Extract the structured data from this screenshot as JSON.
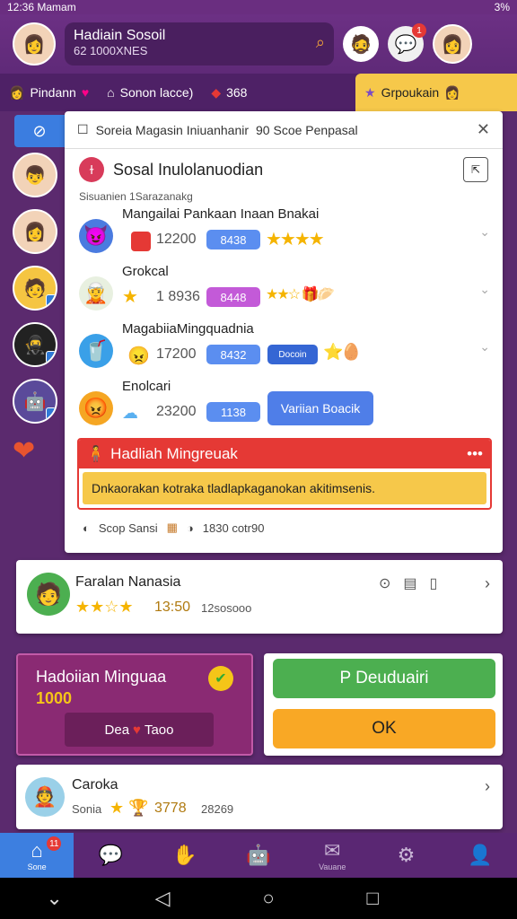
{
  "status": {
    "time": "12:36 Mamam",
    "battery": "3%"
  },
  "header": {
    "name": "Hadiain Sosoil",
    "sub": "62 1000XNES",
    "notif_count": "1"
  },
  "tabs": [
    {
      "label": "Pindann"
    },
    {
      "label": "Sonon lacce)"
    },
    {
      "label": "368"
    },
    {
      "label": "Grpoukain"
    }
  ],
  "panel": {
    "header_text": "Soreia Magasin Iniuanhanir",
    "header_extra": "90 Scoe Penpasal",
    "section_title": "Sosal Inulolanuodian",
    "subtitle": "Sisuanien 1Sarazanakg",
    "rows": [
      {
        "title": "Mangailai Pankaan Inaan Bnakai",
        "extra": "38",
        "score": "12200",
        "pill": "8438"
      },
      {
        "title": "Grokcal",
        "score": "1 8936",
        "pill": "8448"
      },
      {
        "title": "MagabiiaMingquadnia",
        "score": "17200",
        "pill": "8432",
        "pill2": "Docoin"
      },
      {
        "title": "Enolcari",
        "score": "23200",
        "pill": "1138",
        "button": "Variian Boacik"
      }
    ],
    "alert_title": "Hadliah Mingreuak",
    "alert_body": "Dnkaorakan kotraka tladlapkaganokan akitimsenis.",
    "footer_a": "Scop Sansi",
    "footer_b": "1830 cotr90"
  },
  "card1": {
    "title": "Faralan Nanasia",
    "score": "13:50",
    "sub": "12sosooo"
  },
  "promo": {
    "title": "Hadoiian Minguaa",
    "amount": "1000",
    "btn": "Dea",
    "btn2": "Taoo"
  },
  "actions": {
    "green": "P Deuduairi",
    "orange": "OK"
  },
  "card2": {
    "title": "Caroka",
    "sub": "Sonia",
    "score": "3778",
    "extra": "28269"
  },
  "nav": {
    "home": "Sone",
    "mail": "Vauane",
    "home_badge": "11"
  }
}
